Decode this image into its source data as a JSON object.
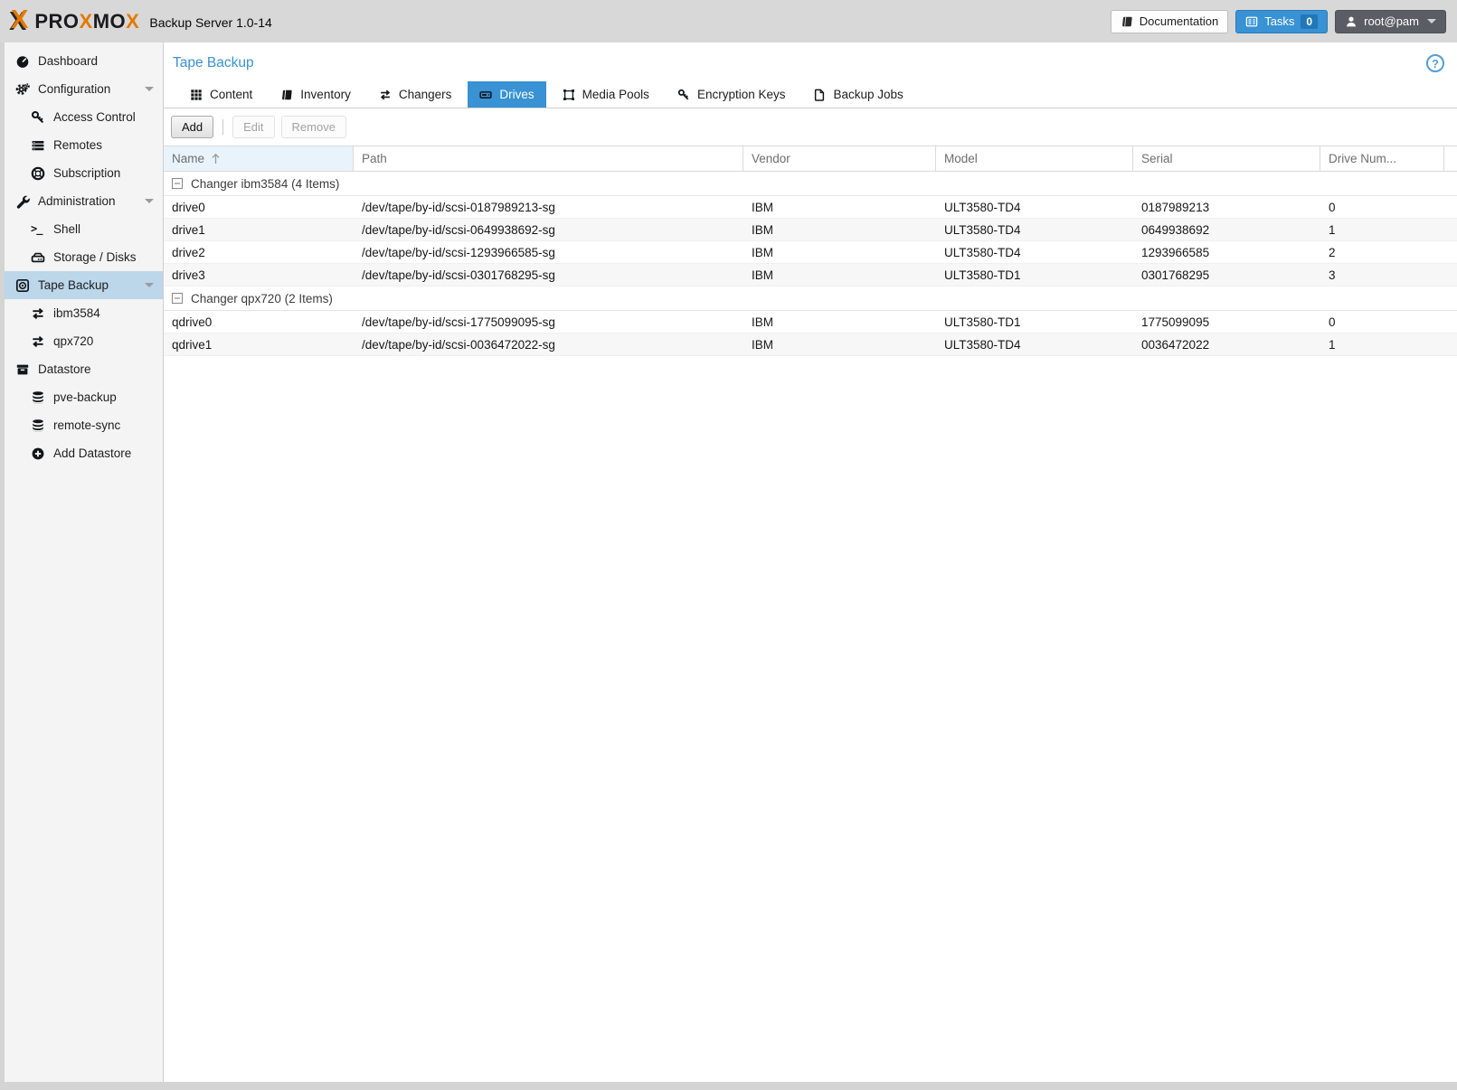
{
  "header": {
    "brand_mark": "X",
    "brand_p1": "PRO",
    "brand_x1": "X",
    "brand_p2": "MO",
    "brand_x2": "X",
    "subtitle": "Backup Server 1.0-14",
    "documentation_label": "Documentation",
    "tasks_label": "Tasks",
    "tasks_count": "0",
    "user_label": "root@pam"
  },
  "colors": {
    "accent": "#3892d4",
    "selected_nav": "#bcd6ea",
    "brand_orange": "#e57800"
  },
  "sidebar": {
    "items": [
      {
        "label": "Dashboard",
        "icon": "gauge-icon",
        "level": 0
      },
      {
        "label": "Configuration",
        "icon": "gears-icon",
        "level": 0,
        "expandable": true
      },
      {
        "label": "Access Control",
        "icon": "key-icon",
        "level": 1
      },
      {
        "label": "Remotes",
        "icon": "list-icon",
        "level": 1
      },
      {
        "label": "Subscription",
        "icon": "life-ring-icon",
        "level": 1
      },
      {
        "label": "Administration",
        "icon": "wrench-icon",
        "level": 0,
        "expandable": true
      },
      {
        "label": "Shell",
        "icon": "terminal-icon",
        "level": 1
      },
      {
        "label": "Storage / Disks",
        "icon": "hdd-icon",
        "level": 1
      },
      {
        "label": "Tape Backup",
        "icon": "tape-icon",
        "level": 0,
        "expandable": true,
        "selected": true
      },
      {
        "label": "ibm3584",
        "icon": "exchange-icon",
        "level": 1
      },
      {
        "label": "qpx720",
        "icon": "exchange-icon",
        "level": 1
      },
      {
        "label": "Datastore",
        "icon": "archive-icon",
        "level": 0
      },
      {
        "label": "pve-backup",
        "icon": "database-icon",
        "level": 1
      },
      {
        "label": "remote-sync",
        "icon": "database-icon",
        "level": 1
      },
      {
        "label": "Add Datastore",
        "icon": "plus-circle-icon",
        "level": 1
      }
    ]
  },
  "content": {
    "title": "Tape Backup",
    "help_label": "?",
    "tabs": [
      {
        "label": "Content",
        "icon": "grid-icon"
      },
      {
        "label": "Inventory",
        "icon": "book-icon"
      },
      {
        "label": "Changers",
        "icon": "exchange-icon"
      },
      {
        "label": "Drives",
        "icon": "tape-drive-icon",
        "selected": true
      },
      {
        "label": "Media Pools",
        "icon": "object-group-icon"
      },
      {
        "label": "Encryption Keys",
        "icon": "key-icon"
      },
      {
        "label": "Backup Jobs",
        "icon": "file-icon"
      }
    ],
    "toolbar": {
      "add": "Add",
      "edit": "Edit",
      "remove": "Remove"
    },
    "table": {
      "columns": [
        "Name",
        "Path",
        "Vendor",
        "Model",
        "Serial",
        "Drive Num..."
      ],
      "sort_column": "Name",
      "sort_direction": "ascending",
      "groups": [
        {
          "label": "Changer ibm3584 (4 Items)",
          "rows": [
            [
              "drive0",
              "/dev/tape/by-id/scsi-0187989213-sg",
              "IBM",
              "ULT3580-TD4",
              "0187989213",
              "0"
            ],
            [
              "drive1",
              "/dev/tape/by-id/scsi-0649938692-sg",
              "IBM",
              "ULT3580-TD4",
              "0649938692",
              "1"
            ],
            [
              "drive2",
              "/dev/tape/by-id/scsi-1293966585-sg",
              "IBM",
              "ULT3580-TD4",
              "1293966585",
              "2"
            ],
            [
              "drive3",
              "/dev/tape/by-id/scsi-0301768295-sg",
              "IBM",
              "ULT3580-TD1",
              "0301768295",
              "3"
            ]
          ]
        },
        {
          "label": "Changer qpx720 (2 Items)",
          "rows": [
            [
              "qdrive0",
              "/dev/tape/by-id/scsi-1775099095-sg",
              "IBM",
              "ULT3580-TD1",
              "1775099095",
              "0"
            ],
            [
              "qdrive1",
              "/dev/tape/by-id/scsi-0036472022-sg",
              "IBM",
              "ULT3580-TD4",
              "0036472022",
              "1"
            ]
          ]
        }
      ]
    }
  }
}
